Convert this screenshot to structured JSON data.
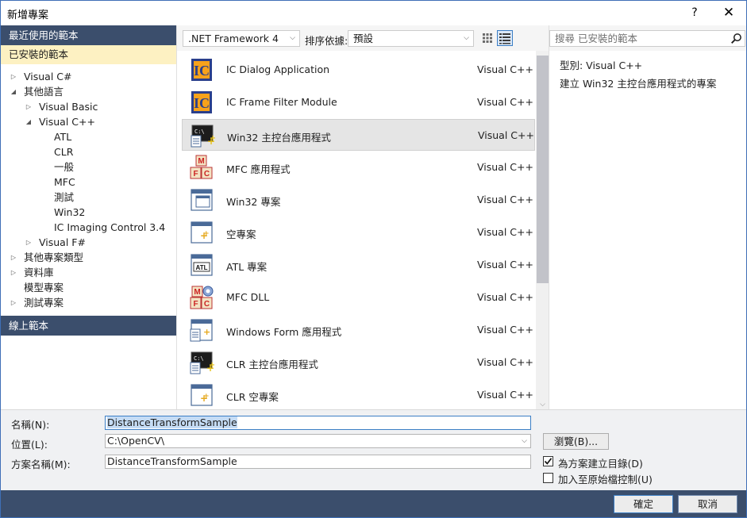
{
  "window": {
    "title": "新增專案",
    "help_label": "?",
    "close_label": "✕"
  },
  "sidebar": {
    "recent_label": "最近使用的範本",
    "installed_label": "已安裝的範本",
    "online_label": "線上範本",
    "tree": [
      {
        "label": "Visual C#",
        "arrow": "▷"
      },
      {
        "label": "其他語言",
        "arrow": "◢"
      },
      {
        "label": "Visual Basic",
        "arrow": "▷"
      },
      {
        "label": "Visual C++",
        "arrow": "◢"
      },
      {
        "label": "ATL",
        "arrow": ""
      },
      {
        "label": "CLR",
        "arrow": ""
      },
      {
        "label": "一般",
        "arrow": ""
      },
      {
        "label": "MFC",
        "arrow": ""
      },
      {
        "label": "測試",
        "arrow": ""
      },
      {
        "label": "Win32",
        "arrow": ""
      },
      {
        "label": "IC Imaging Control 3.4",
        "arrow": ""
      },
      {
        "label": "Visual F#",
        "arrow": "▷"
      },
      {
        "label": "其他專案類型",
        "arrow": "▷"
      },
      {
        "label": "資料庫",
        "arrow": "▷"
      },
      {
        "label": "模型專案",
        "arrow": ""
      },
      {
        "label": "測試專案",
        "arrow": "▷"
      }
    ]
  },
  "toolbar": {
    "framework": ".NET Framework 4",
    "sort_label": "排序依據:",
    "sort_value": "預設"
  },
  "templates": [
    {
      "name": "IC Dialog Application",
      "lang": "Visual C++",
      "icon": "ic-icon"
    },
    {
      "name": "IC Frame Filter Module",
      "lang": "Visual C++",
      "icon": "ic-icon"
    },
    {
      "name": "Win32 主控台應用程式",
      "lang": "Visual C++",
      "icon": "console-icon"
    },
    {
      "name": "MFC 應用程式",
      "lang": "Visual C++",
      "icon": "mfc-icon"
    },
    {
      "name": "Win32 專案",
      "lang": "Visual C++",
      "icon": "window-icon"
    },
    {
      "name": "空專案",
      "lang": "Visual C++",
      "icon": "empty-project-icon"
    },
    {
      "name": "ATL 專案",
      "lang": "Visual C++",
      "icon": "atl-icon"
    },
    {
      "name": "MFC DLL",
      "lang": "Visual C++",
      "icon": "mfc-dll-icon"
    },
    {
      "name": "Windows Form 應用程式",
      "lang": "Visual C++",
      "icon": "form-icon"
    },
    {
      "name": "CLR 主控台應用程式",
      "lang": "Visual C++",
      "icon": "console-icon"
    },
    {
      "name": "CLR 空專案",
      "lang": "Visual C++",
      "icon": "empty-project-icon"
    }
  ],
  "right": {
    "search_placeholder": "搜尋 已安裝的範本",
    "type_line": "型別:  Visual C++",
    "description": "建立 Win32 主控台應用程式的專案"
  },
  "form": {
    "name_label": "名稱(N):",
    "name_value": "DistanceTransformSample",
    "location_label": "位置(L):",
    "location_value": "C:\\OpenCV\\",
    "solution_label": "方案名稱(M):",
    "solution_value": "DistanceTransformSample",
    "browse_label": "瀏覽(B)...",
    "create_dir_label": "為方案建立目錄(D)",
    "create_dir_checked": true,
    "source_control_label": "加入至原始檔控制(U)",
    "source_control_checked": false
  },
  "buttons": {
    "ok": "確定",
    "cancel": "取消"
  },
  "selected_index": 2
}
